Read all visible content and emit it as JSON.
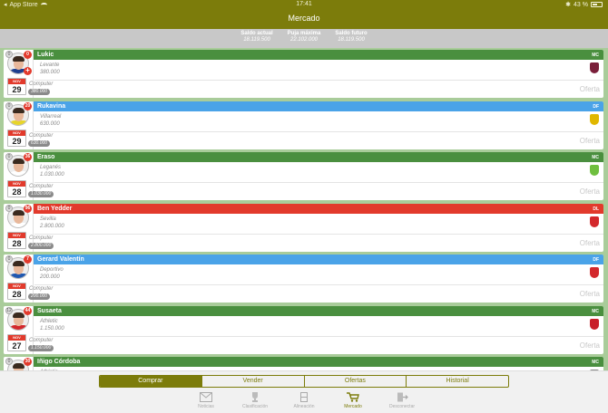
{
  "status_bar": {
    "carrier": "App Store",
    "time": "17:41",
    "battery": "43 %"
  },
  "nav": {
    "title": "Mercado"
  },
  "balances": [
    {
      "label": "Saldo actual",
      "value": "18.119.500"
    },
    {
      "label": "Puja máxima",
      "value": "22.102.000"
    },
    {
      "label": "Saldo futuro",
      "value": "18.119.500"
    }
  ],
  "players": [
    {
      "name": "Lukic",
      "pos": "MC",
      "team": "Levante",
      "value": "380.000",
      "buyer": "Computer",
      "offer_value": "380.000",
      "month": "NOV",
      "day": "29",
      "pts": "0",
      "badge": "0",
      "head_color": "#4a8f3f",
      "shirt": "#1d3f8f",
      "crest": "#7a1f3a",
      "plus": "+"
    },
    {
      "name": "Rukavina",
      "pos": "DF",
      "team": "Villarreal",
      "value": "630.000",
      "buyer": "Computer",
      "offer_value": "630.000",
      "month": "NOV",
      "day": "29",
      "pts": "0",
      "badge": "20",
      "head_color": "#4aa3e8",
      "shirt": "#e7d52a",
      "crest": "#e0b700",
      "plus": ""
    },
    {
      "name": "Eraso",
      "pos": "MC",
      "team": "Leganés",
      "value": "1.030.000",
      "buyer": "Computer",
      "offer_value": "1.030.000",
      "month": "NOV",
      "day": "28",
      "pts": "0",
      "badge": "36",
      "head_color": "#4a8f3f",
      "shirt": "#ffffff",
      "crest": "#6fbf3f",
      "plus": ""
    },
    {
      "name": "Ben Yedder",
      "pos": "DL",
      "team": "Sevilla",
      "value": "2.800.000",
      "buyer": "Computer",
      "offer_value": "2.800.000",
      "month": "NOV",
      "day": "28",
      "pts": "0",
      "badge": "96",
      "head_color": "#e23a2c",
      "shirt": "#ffffff",
      "crest": "#d3282c",
      "plus": ""
    },
    {
      "name": "Gerard Valentín",
      "pos": "DF",
      "team": "Deportivo",
      "value": "200.000",
      "buyer": "Computer",
      "offer_value": "200.000",
      "month": "NOV",
      "day": "28",
      "pts": "0",
      "badge": "7",
      "head_color": "#4aa3e8",
      "shirt": "#1f58b0",
      "crest": "#d3282c",
      "plus": ""
    },
    {
      "name": "Susaeta",
      "pos": "MC",
      "team": "Athletic",
      "value": "1.150.000",
      "buyer": "Computer",
      "offer_value": "1.150.000",
      "month": "NOV",
      "day": "27",
      "pts": "12",
      "badge": "44",
      "head_color": "#4a8f3f",
      "shirt": "#d3282c",
      "crest": "#c8202a",
      "plus": ""
    },
    {
      "name": "Iñigo Córdoba",
      "pos": "MC",
      "team": "Athletic",
      "value": "",
      "buyer": "",
      "offer_value": "",
      "month": "",
      "day": "",
      "pts": "0",
      "badge": "30",
      "head_color": "#4a8f3f",
      "shirt": "#d3282c",
      "crest": "#888888",
      "plus": ""
    }
  ],
  "offer_label": "Oferta",
  "segments": [
    "Comprar",
    "Vender",
    "Ofertas",
    "Historial"
  ],
  "tabs": [
    {
      "label": "Noticias",
      "icon": "envelope-icon"
    },
    {
      "label": "Clasificación",
      "icon": "trophy-icon"
    },
    {
      "label": "Alineación",
      "icon": "lineup-icon"
    },
    {
      "label": "Mercado",
      "icon": "cart-icon"
    },
    {
      "label": "Desconectar",
      "icon": "logout-icon"
    }
  ]
}
